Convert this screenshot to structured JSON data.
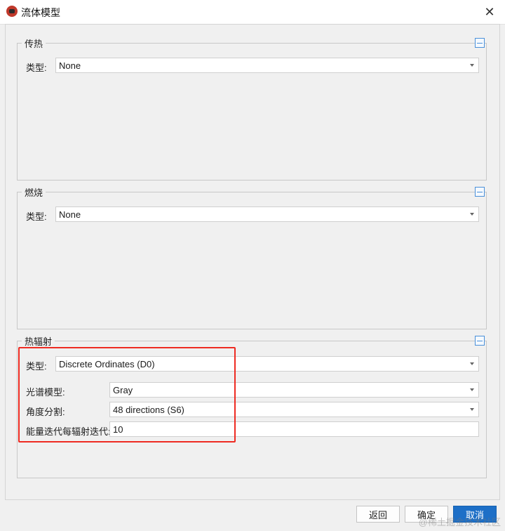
{
  "window": {
    "title": "流体模型",
    "close_symbol": "✕"
  },
  "groups": {
    "heat_transfer": {
      "title": "传热",
      "type_label": "类型:",
      "type_value": "None"
    },
    "combustion": {
      "title": "燃烧",
      "type_label": "类型:",
      "type_value": "None"
    },
    "radiation": {
      "title": "热辐射",
      "type_label": "类型:",
      "type_value": "Discrete Ordinates (D0)",
      "spectral_label": "光谱模型:",
      "spectral_value": "Gray",
      "angular_label": "角度分割:",
      "angular_value": "48 directions (S6)",
      "iterations_label": "能量迭代每辐射迭代:",
      "iterations_value": "10"
    }
  },
  "buttons": {
    "back": "返回",
    "ok": "确定",
    "cancel": "取消"
  },
  "watermark": "@稀土掘金技术社区",
  "colors": {
    "highlight": "#ee2b22",
    "primary": "#1d6fc7",
    "collapse": "#4a90d9"
  }
}
